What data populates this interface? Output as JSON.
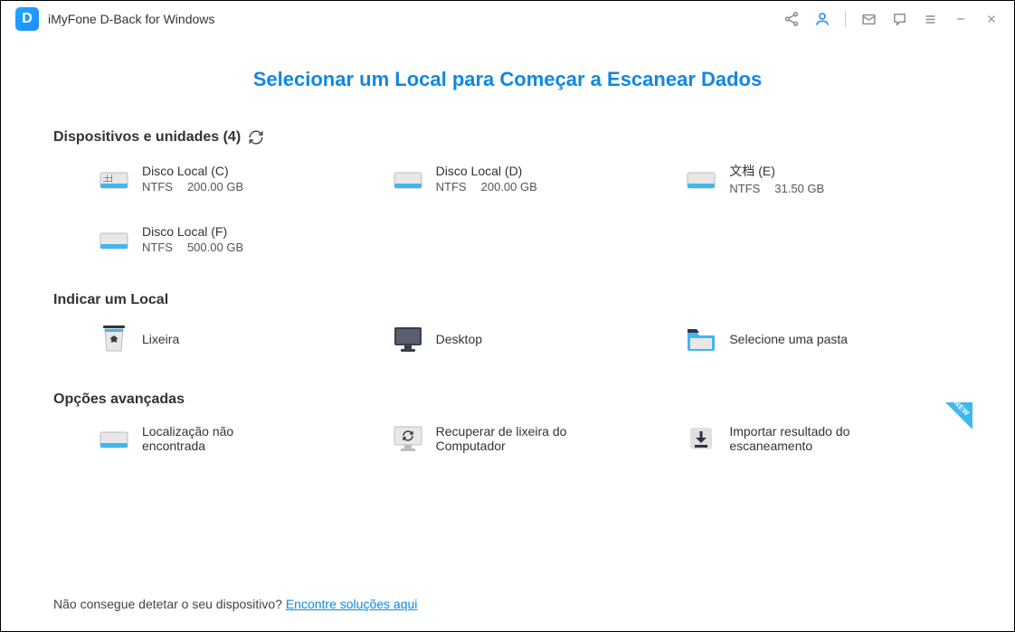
{
  "app": {
    "title": "iMyFone D-Back for Windows",
    "logo_letter": "D"
  },
  "page_title": "Selecionar um Local para Começar a Escanear Dados",
  "sections": {
    "devices": {
      "header": "Dispositivos e unidades (4)"
    },
    "location": {
      "header": "Indicar um Local"
    },
    "advanced": {
      "header": "Opções avançadas"
    }
  },
  "drives": [
    {
      "name": "Disco Local (C)",
      "fs": "NTFS",
      "size": "200.00 GB",
      "os": true
    },
    {
      "name": "Disco Local (D)",
      "fs": "NTFS",
      "size": "200.00 GB",
      "os": false
    },
    {
      "name": "文档 (E)",
      "fs": "NTFS",
      "size": "31.50 GB",
      "os": false
    },
    {
      "name": "Disco Local (F)",
      "fs": "NTFS",
      "size": "500.00 GB",
      "os": false
    }
  ],
  "locations": [
    {
      "name": "Lixeira",
      "icon": "recycle"
    },
    {
      "name": "Desktop",
      "icon": "desktop"
    },
    {
      "name": "Selecione uma pasta",
      "icon": "folder"
    }
  ],
  "advanced": [
    {
      "name": "Localização não encontrada",
      "icon": "drive-search"
    },
    {
      "name": "Recuperar de lixeira do Computador",
      "icon": "refresh-monitor"
    },
    {
      "name": "Importar resultado do escaneamento",
      "icon": "import",
      "new": true
    }
  ],
  "new_label": "NEW",
  "footer": {
    "text": "Não consegue detetar o seu dispositivo? ",
    "link": "Encontre soluções aqui"
  }
}
